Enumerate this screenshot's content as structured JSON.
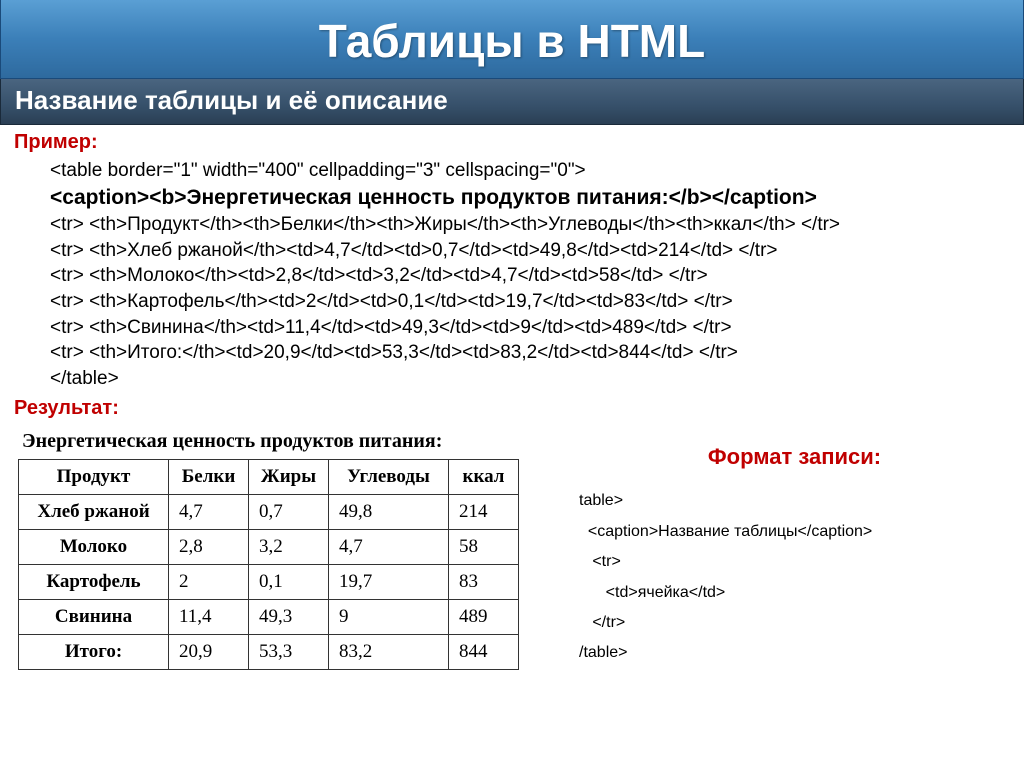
{
  "header": {
    "title": "Таблицы в HTML",
    "subtitle": "Название таблицы и её описание"
  },
  "labels": {
    "example": "Пример:",
    "result": "Результат:",
    "format": "Формат записи:"
  },
  "code": {
    "line1": "<table border=\"1\" width=\"400\" cellpadding=\"3\" cellspacing=\"0\">",
    "line2": "<caption><b>Энергетическая ценность продуктов питания:</b></caption>",
    "line3": "<tr> <th>Продукт</th><th>Белки</th><th>Жиры</th><th>Углеводы</th><th>ккал</th> </tr>",
    "line4": "<tr> <th>Хлеб ржаной</th><td>4,7</td><td>0,7</td><td>49,8</td><td>214</td> </tr>",
    "line5": "<tr> <th>Молоко</th><td>2,8</td><td>3,2</td><td>4,7</td><td>58</td> </tr>",
    "line6": "<tr> <th>Картофель</th><td>2</td><td>0,1</td><td>19,7</td><td>83</td> </tr>",
    "line7": "<tr> <th>Свинина</th><td>11,4</td><td>49,3</td><td>9</td><td>489</td> </tr>",
    "line8": "<tr> <th>Итого:</th><td>20,9</td><td>53,3</td><td>83,2</td><td>844</td> </tr>",
    "line9": "</table>"
  },
  "result_table": {
    "caption": "Энергетическая ценность продуктов питания:",
    "headers": [
      "Продукт",
      "Белки",
      "Жиры",
      "Углеводы",
      "ккал"
    ],
    "rows": [
      {
        "name": "Хлеб ржаной",
        "c1": "4,7",
        "c2": "0,7",
        "c3": "49,8",
        "c4": "214"
      },
      {
        "name": "Молоко",
        "c1": "2,8",
        "c2": "3,2",
        "c3": "4,7",
        "c4": "58"
      },
      {
        "name": "Картофель",
        "c1": "2",
        "c2": "0,1",
        "c3": "19,7",
        "c4": "83"
      },
      {
        "name": "Свинина",
        "c1": "11,4",
        "c2": "49,3",
        "c3": "9",
        "c4": "489"
      },
      {
        "name": "Итого:",
        "c1": "20,9",
        "c2": "53,3",
        "c3": "83,2",
        "c4": "844"
      }
    ]
  },
  "format": {
    "l1": "table>",
    "l2": "  <caption>Название таблицы</caption>",
    "l3": "   <tr>",
    "l4": "      <td>ячейка</td>",
    "l5": "   </tr>",
    "l6": "/table>"
  }
}
